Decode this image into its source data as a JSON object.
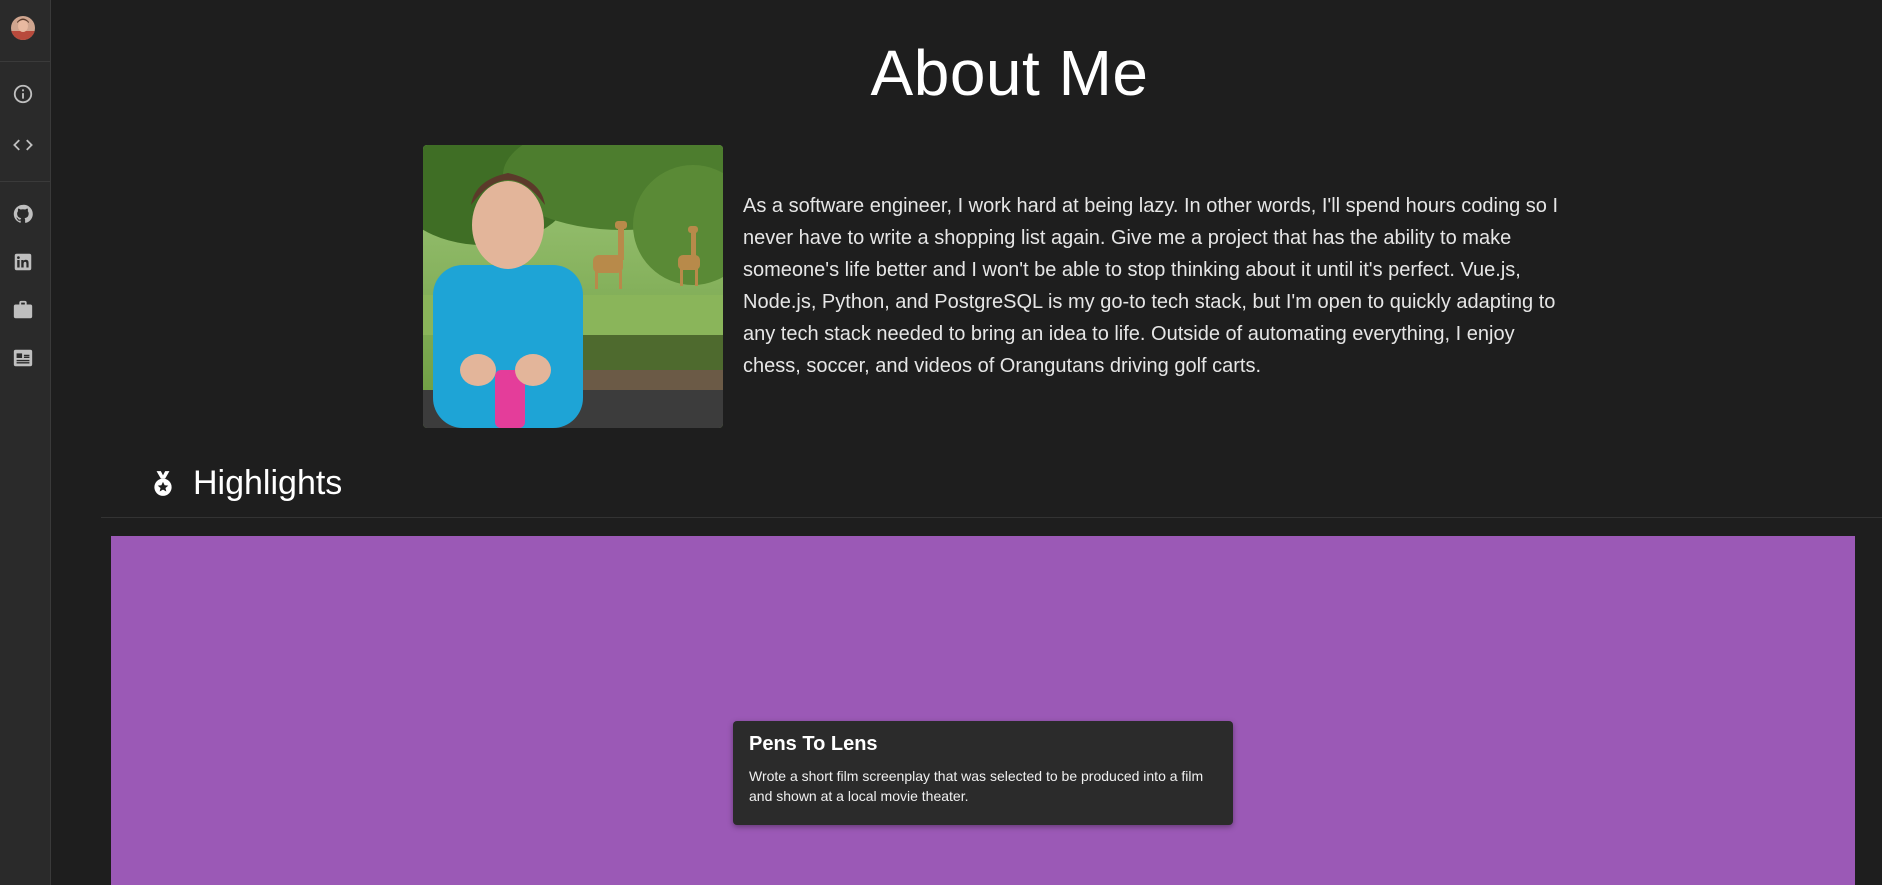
{
  "page": {
    "title": "About Me",
    "bio": "As a software engineer, I work hard at being lazy. In other words, I'll spend hours coding so I never have to write a shopping list again. Give me a project that has the ability to make someone's life better and I won't be able to stop thinking about it until it's perfect. Vue.js, Node.js, Python, and PostgreSQL is my go-to tech stack, but I'm open to quickly adapting to any tech stack needed to bring an idea to life. Outside of automating everything, I enjoy chess, soccer, and videos of Orangutans driving golf carts."
  },
  "sidebar": {
    "items": [
      {
        "icon": "info-icon"
      },
      {
        "icon": "code-icon"
      },
      {
        "icon": "github-icon"
      },
      {
        "icon": "linkedin-icon"
      },
      {
        "icon": "briefcase-icon"
      },
      {
        "icon": "newspaper-icon"
      }
    ]
  },
  "highlights": {
    "title": "Highlights",
    "icon": "medal-icon",
    "background_color": "#9b59b6",
    "items": [
      {
        "title": "Pens To Lens",
        "description": "Wrote a short film screenplay that was selected to be produced into a film and shown at a local movie theater."
      }
    ]
  },
  "colors": {
    "background": "#1e1e1e",
    "sidebar": "#2a2a2a",
    "card": "#2b2b2b",
    "accent": "#9b59b6"
  }
}
